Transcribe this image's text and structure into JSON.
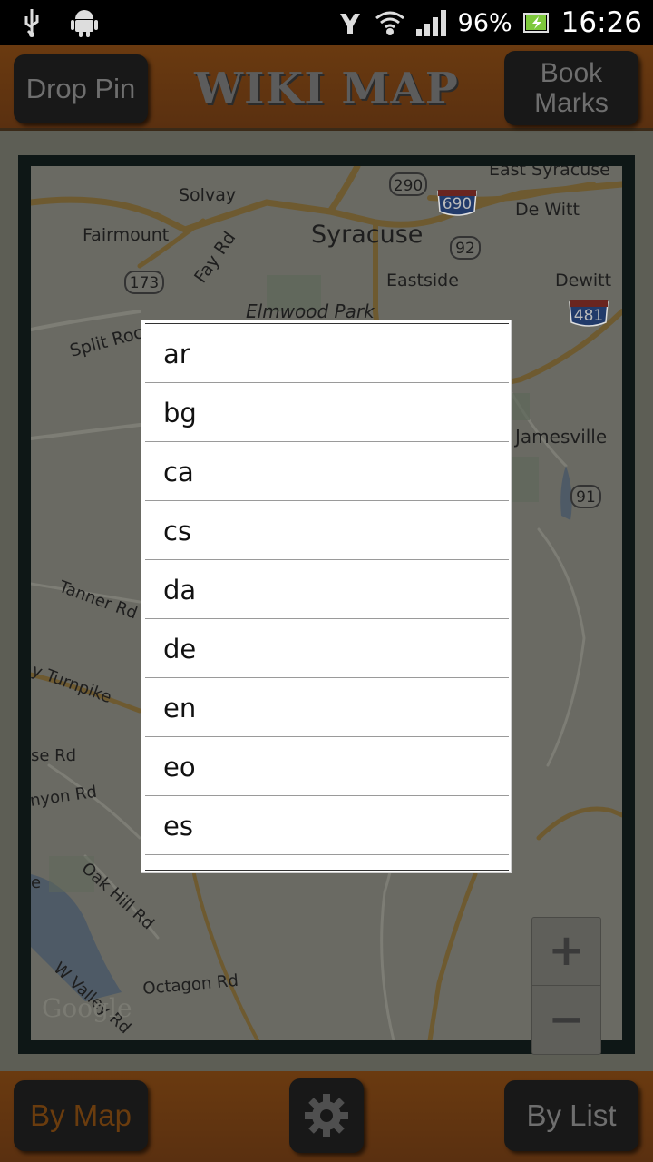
{
  "status_bar": {
    "icons": [
      "usb-icon",
      "android-icon",
      "network-icon",
      "wifi-icon",
      "signal-icon",
      "battery-icon"
    ],
    "battery": "96%",
    "time": "16:26"
  },
  "header": {
    "title": "WIKI MAP",
    "drop_pin": "Drop Pin",
    "bookmarks_line1": "Book",
    "bookmarks_line2": "Marks"
  },
  "map": {
    "labels": {
      "east_syracuse": "East Syracuse",
      "solvay": "Solvay",
      "fairmount": "Fairmount",
      "syracuse": "Syracuse",
      "de_witt": "De Witt",
      "eastside": "Eastside",
      "dewitt": "Dewitt",
      "elmwood_park": "Elmwood Park",
      "split_rock": "Split Roc",
      "fay_rd": "Fay Rd",
      "jamesville": "Jamesville",
      "tanner_rd": "Tanner Rd",
      "turnpike": "y Turnpike",
      "se_rd": "se Rd",
      "nyon_rd": "nyon Rd",
      "oak_hill_rd": "Oak Hill Rd",
      "octagon_rd": "Octagon Rd",
      "w_valley": "W Valley Rd",
      "e_label": "e",
      "google": "Google"
    },
    "shields": {
      "r290": "290",
      "r690": "690",
      "r92": "92",
      "r173": "173",
      "r481": "481",
      "r91": "91"
    },
    "zoom_in": "+",
    "zoom_out": "−"
  },
  "dialog": {
    "items": [
      "ar",
      "bg",
      "ca",
      "cs",
      "da",
      "de",
      "en",
      "eo",
      "es"
    ]
  },
  "footer": {
    "by_map": "By Map",
    "settings_icon": "gear-icon",
    "by_list": "By List"
  }
}
